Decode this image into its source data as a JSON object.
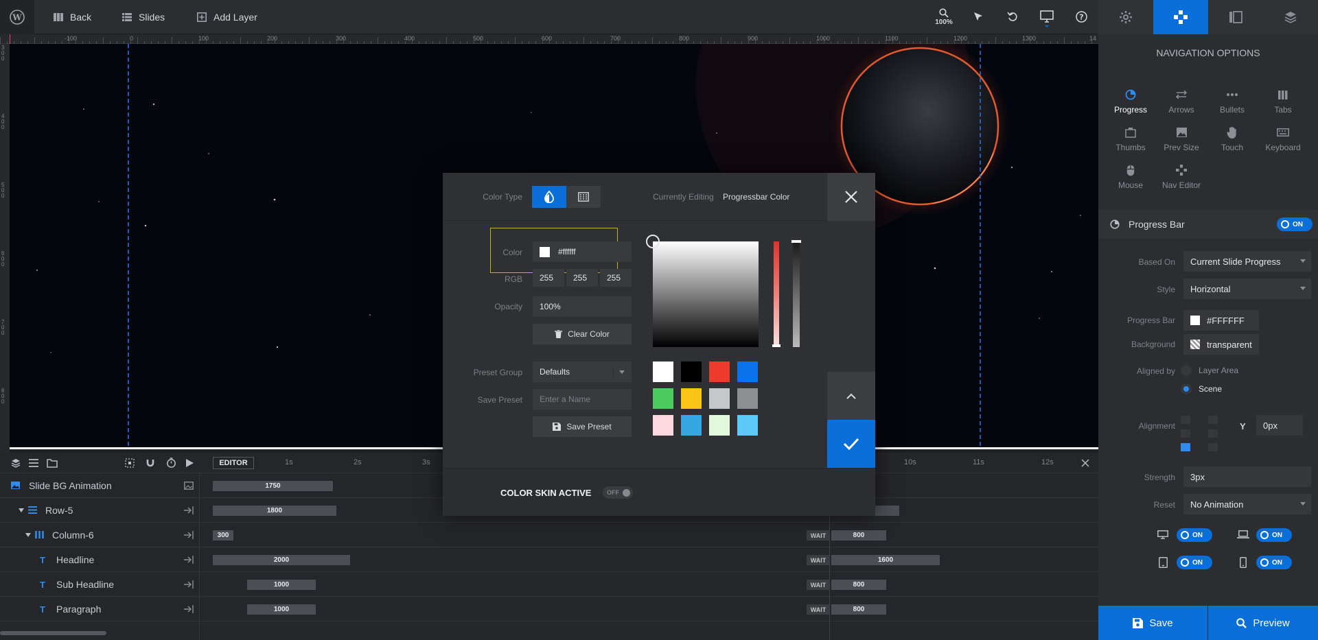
{
  "topbar": {
    "back_label": "Back",
    "slides_label": "Slides",
    "add_layer_label": "Add Layer",
    "zoom": "100%"
  },
  "ruler": {
    "top_ticks": [
      "-100",
      "0",
      "100",
      "200",
      "300",
      "400",
      "500",
      "600",
      "700",
      "800",
      "900",
      "1000",
      "1100",
      "1200",
      "1300",
      "14"
    ],
    "left_ticks": [
      "300",
      "400",
      "500",
      "600",
      "700",
      "800"
    ]
  },
  "right_panel": {
    "title": "NAVIGATION OPTIONS",
    "nav_options": [
      {
        "label": "Progress",
        "icon": "progress-icon",
        "active": true
      },
      {
        "label": "Arrows",
        "icon": "arrows-icon"
      },
      {
        "label": "Bullets",
        "icon": "bullets-icon"
      },
      {
        "label": "Tabs",
        "icon": "tabs-icon"
      },
      {
        "label": "Thumbs",
        "icon": "thumbs-icon"
      },
      {
        "label": "Prev Size",
        "icon": "image-icon"
      },
      {
        "label": "Touch",
        "icon": "hand-icon"
      },
      {
        "label": "Keyboard",
        "icon": "keyboard-icon"
      },
      {
        "label": "Mouse",
        "icon": "mouse-icon"
      },
      {
        "label": "Nav Editor",
        "icon": "gamepad-icon"
      }
    ],
    "section_title": "Progress Bar",
    "section_toggle": "ON",
    "based_on_label": "Based On",
    "based_on_value": "Current Slide Progress",
    "style_label": "Style",
    "style_value": "Horizontal",
    "progress_bar_label": "Progress Bar",
    "progress_bar_value": "#FFFFFF",
    "background_label": "Background",
    "background_value": "transparent",
    "aligned_by_label": "Aligned by",
    "aligned_opt1": "Layer Area",
    "aligned_opt2": "Scene",
    "alignment_label": "Alignment",
    "y_label": "Y",
    "y_value": "0px",
    "strength_label": "Strength",
    "strength_value": "3px",
    "reset_label": "Reset",
    "reset_value": "No Animation",
    "device_toggles": [
      "ON",
      "ON",
      "ON",
      "ON"
    ],
    "save_label": "Save",
    "preview_label": "Preview"
  },
  "timeline": {
    "editor_label": "EDITOR",
    "time_marks": [
      "1s",
      "2s",
      "3s",
      "10s",
      "11s",
      "12s"
    ],
    "rows": [
      {
        "name": "Slide BG Animation",
        "bar": "1750"
      },
      {
        "name": "Row-5",
        "bar": "1800"
      },
      {
        "name": "Column-6",
        "bar": "300",
        "wait": "WAIT",
        "end": "800"
      },
      {
        "name": "Headline",
        "bar": "2000",
        "wait": "WAIT",
        "end": "1600"
      },
      {
        "name": "Sub Headline",
        "bar": "1000",
        "wait": "WAIT",
        "end": "800"
      },
      {
        "name": "Paragraph",
        "bar": "1000",
        "wait": "WAIT",
        "end": "800"
      }
    ]
  },
  "modal": {
    "color_type_label": "Color Type",
    "currently_editing_label": "Currently Editing",
    "currently_editing_value": "Progressbar Color",
    "color_label": "Color",
    "color_value": "#ffffff",
    "rgb_label": "RGB",
    "rgb": [
      "255",
      "255",
      "255"
    ],
    "opacity_label": "Opacity",
    "opacity_value": "100%",
    "clear_color_label": "Clear Color",
    "preset_group_label": "Preset Group",
    "preset_group_value": "Defaults",
    "save_preset_label": "Save Preset",
    "save_preset_placeholder": "Enter a Name",
    "save_preset_button": "Save Preset",
    "color_skin_label": "COLOR SKIN ACTIVE",
    "color_skin_toggle": "OFF",
    "presets": [
      "#ffffff",
      "#000000",
      "#ec3a2c",
      "#0a73ec",
      "#4ccc5e",
      "#fcc417",
      "#c6c7c9",
      "#8d8e90",
      "#fdd8df",
      "#36a6e2",
      "#e2f7db",
      "#5ec8f8"
    ]
  }
}
